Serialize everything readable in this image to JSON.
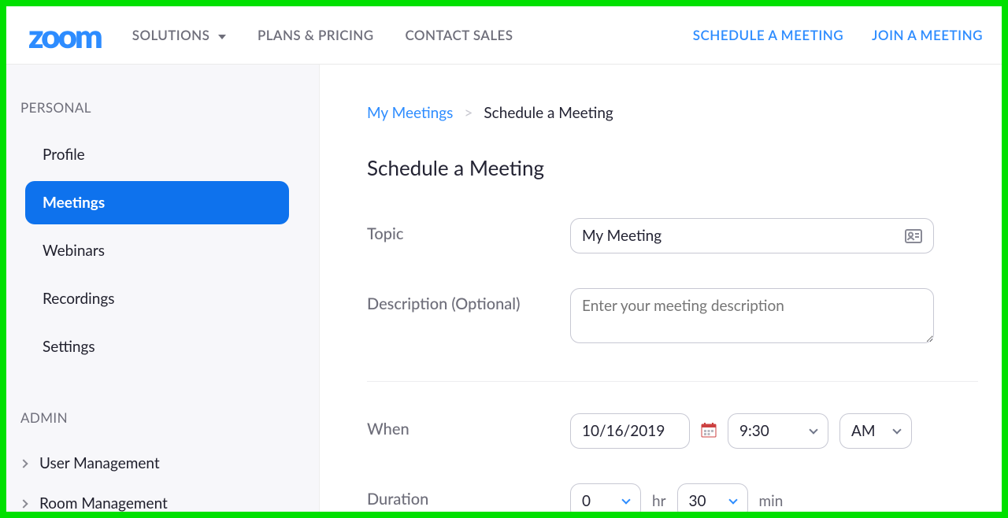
{
  "topnav": {
    "logo": "zoom",
    "items": [
      "SOLUTIONS",
      "PLANS & PRICING",
      "CONTACT SALES"
    ],
    "right": [
      "SCHEDULE A MEETING",
      "JOIN A MEETING"
    ]
  },
  "sidebar": {
    "personal_label": "PERSONAL",
    "personal_items": [
      {
        "label": "Profile",
        "active": false
      },
      {
        "label": "Meetings",
        "active": true
      },
      {
        "label": "Webinars",
        "active": false
      },
      {
        "label": "Recordings",
        "active": false
      },
      {
        "label": "Settings",
        "active": false
      }
    ],
    "admin_label": "ADMIN",
    "admin_items": [
      {
        "label": "User Management"
      },
      {
        "label": "Room Management"
      }
    ]
  },
  "breadcrumb": {
    "root": "My Meetings",
    "sep": ">",
    "current": "Schedule a Meeting"
  },
  "page_title": "Schedule a Meeting",
  "form": {
    "topic_label": "Topic",
    "topic_value": "My Meeting",
    "description_label": "Description (Optional)",
    "description_placeholder": "Enter your meeting description",
    "when_label": "When",
    "when_date": "10/16/2019",
    "when_time": "9:30",
    "when_ampm": "AM",
    "duration_label": "Duration",
    "duration_hr": "0",
    "duration_hr_unit": "hr",
    "duration_min": "30",
    "duration_min_unit": "min"
  }
}
